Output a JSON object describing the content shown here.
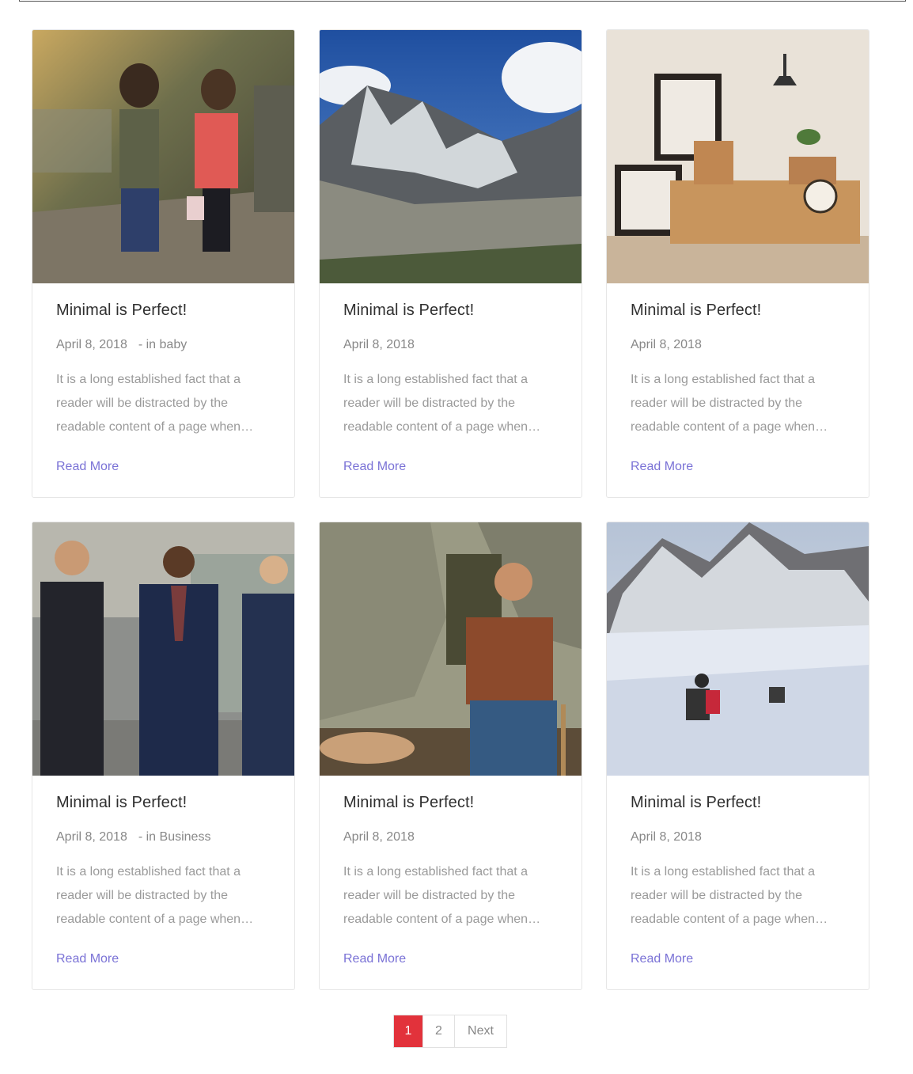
{
  "posts": [
    {
      "title": "Minimal is Perfect!",
      "date": "April 8, 2018",
      "category_prefix": "- in",
      "category": "baby",
      "excerpt": "It is a long established fact that a reader will be distracted by the readable content of a page when…",
      "read_more": "Read More",
      "image": "children-walking-photo"
    },
    {
      "title": "Minimal is Perfect!",
      "date": "April 8, 2018",
      "category_prefix": "",
      "category": "",
      "excerpt": "It is a long established fact that a reader will be distracted by the readable content of a page when…",
      "read_more": "Read More",
      "image": "mountain-valley-photo"
    },
    {
      "title": "Minimal is Perfect!",
      "date": "April 8, 2018",
      "category_prefix": "",
      "category": "",
      "excerpt": "It is a long established fact that a reader will be distracted by the readable content of a page when…",
      "read_more": "Read More",
      "image": "moving-boxes-room-photo"
    },
    {
      "title": "Minimal is Perfect!",
      "date": "April 8, 2018",
      "category_prefix": "- in",
      "category": "Business",
      "excerpt": "It is a long established fact that a reader will be distracted by the readable content of a page when…",
      "read_more": "Read More",
      "image": "businessmen-walking-photo"
    },
    {
      "title": "Minimal is Perfect!",
      "date": "April 8, 2018",
      "category_prefix": "",
      "category": "",
      "excerpt": "It is a long established fact that a reader will be distracted by the readable content of a page when…",
      "read_more": "Read More",
      "image": "hiker-backpack-photo"
    },
    {
      "title": "Minimal is Perfect!",
      "date": "April 8, 2018",
      "category_prefix": "",
      "category": "",
      "excerpt": "It is a long established fact that a reader will be distracted by the readable content of a page when…",
      "read_more": "Read More",
      "image": "snow-climbers-photo"
    }
  ],
  "pagination": {
    "pages": [
      "1",
      "2"
    ],
    "current": "1",
    "next_label": "Next"
  },
  "colors": {
    "accent": "#7a72d6",
    "active_page": "#e2323b",
    "title": "#2f2f2f",
    "meta": "#888888"
  }
}
